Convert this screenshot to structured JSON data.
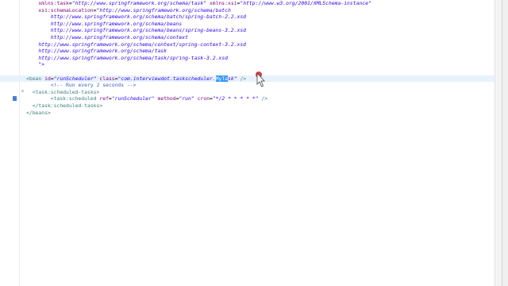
{
  "editor": {
    "lines": [
      [
        {
          "t": "    "
        },
        {
          "t": "xmlns:task",
          "c": "a"
        },
        {
          "t": "="
        },
        {
          "t": "\"http://www.springframework.org/schema/task\"",
          "c": "v"
        },
        {
          "t": " "
        },
        {
          "t": "xmlns:xsi",
          "c": "a"
        },
        {
          "t": "="
        },
        {
          "t": "\"http://www.w3.org/2001/XMLSchema-instance\"",
          "c": "v"
        }
      ],
      [
        {
          "t": "    "
        },
        {
          "t": "xsi:schemaLocation",
          "c": "a"
        },
        {
          "t": "="
        },
        {
          "t": "\"http://www.springframework.org/schema/batch",
          "c": "v"
        }
      ],
      [
        {
          "t": "        "
        },
        {
          "t": "http://www.springframework.org/schema/batch/spring-batch-2.2.xsd",
          "c": "v"
        }
      ],
      [
        {
          "t": "        "
        },
        {
          "t": "http://www.springframework.org/schema/beans",
          "c": "v"
        }
      ],
      [
        {
          "t": "        "
        },
        {
          "t": "http://www.springframework.org/schema/beans/spring-beans-3.2.xsd",
          "c": "v"
        }
      ],
      [
        {
          "t": "        "
        },
        {
          "t": "http://www.springframework.org/schema/context",
          "c": "v"
        }
      ],
      [
        {
          "t": "    "
        },
        {
          "t": "http://www.springframework.org/schema/context/spring-context-3.2.xsd",
          "c": "v"
        }
      ],
      [
        {
          "t": "    "
        },
        {
          "t": "http://www.springframework.org/schema/task",
          "c": "v"
        }
      ],
      [
        {
          "t": "    "
        },
        {
          "t": "http://www.springframework.org/schema/task/spring-task-3.2.xsd",
          "c": "v"
        }
      ],
      [
        {
          "t": "    "
        },
        {
          "t": "\">",
          "c": "v"
        }
      ],
      [],
      [
        {
          "t": "<",
          "c": "t"
        },
        {
          "t": "bean",
          "c": "t"
        },
        {
          "t": " "
        },
        {
          "t": "id",
          "c": "a"
        },
        {
          "t": "="
        },
        {
          "t": "\"runScheduler\"",
          "c": "v"
        },
        {
          "t": " "
        },
        {
          "t": "class",
          "c": "a"
        },
        {
          "t": "="
        },
        {
          "t": "\"com.interviewdot.taskscheduler.",
          "c": "v"
        },
        {
          "t": "MyTa",
          "c": "sel"
        },
        {
          "t": "sk\"",
          "c": "v"
        },
        {
          "t": " "
        },
        {
          "t": "/>",
          "c": "t"
        }
      ],
      [
        {
          "t": "        "
        },
        {
          "t": "<!-- Run every 2 seconds -->",
          "c": "c"
        }
      ],
      [
        {
          "t": "  "
        },
        {
          "t": "<",
          "c": "t"
        },
        {
          "t": "task:scheduled-tasks",
          "c": "t"
        },
        {
          "t": ">",
          "c": "t"
        }
      ],
      [
        {
          "t": "        "
        },
        {
          "t": "<",
          "c": "t"
        },
        {
          "t": "task:scheduled",
          "c": "t"
        },
        {
          "t": " "
        },
        {
          "t": "ref",
          "c": "a"
        },
        {
          "t": "="
        },
        {
          "t": "\"runScheduler\"",
          "c": "v"
        },
        {
          "t": " "
        },
        {
          "t": "method",
          "c": "a"
        },
        {
          "t": "="
        },
        {
          "t": "\"run\"",
          "c": "v"
        },
        {
          "t": " "
        },
        {
          "t": "cron",
          "c": "a"
        },
        {
          "t": "="
        },
        {
          "t": "\"*/2 * * * * *\"",
          "c": "v"
        },
        {
          "t": " "
        },
        {
          "t": "/>",
          "c": "t"
        }
      ],
      [
        {
          "t": "  "
        },
        {
          "t": "</",
          "c": "t"
        },
        {
          "t": "task:scheduled-tasks",
          "c": "t"
        },
        {
          "t": ">",
          "c": "t"
        }
      ],
      [
        {
          "t": "</",
          "c": "t"
        },
        {
          "t": "beans",
          "c": "t"
        },
        {
          "t": ">",
          "c": "t"
        }
      ]
    ],
    "current_line": 11,
    "fold_markers": {
      "13": "⊝"
    },
    "bookmark_lines": [
      14
    ],
    "selection_color": "#3399ff",
    "current_line_color": "#e8f2fe"
  },
  "cursor": {
    "icon": "mouse-pointer-icon"
  }
}
